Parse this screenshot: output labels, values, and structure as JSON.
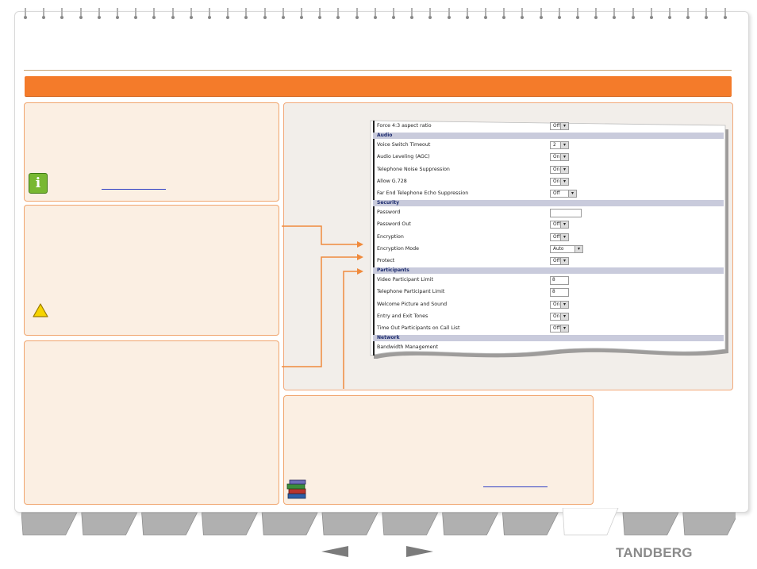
{
  "brand": {
    "name": "TANDBERG"
  },
  "colors": {
    "accent": "#f47b2a",
    "box_border": "#f0a56e",
    "box_fill": "#fbefe3",
    "link": "#2f3fc4",
    "tab": "#b0b0b0"
  },
  "icons": {
    "info": "info-icon",
    "warning": "warning-icon",
    "books": "books-icon",
    "prev": "previous-arrow-icon",
    "next": "next-arrow-icon"
  },
  "info_icon_glyph": "i",
  "settings": {
    "rows": [
      {
        "label": "Force 4:3 aspect ratio",
        "type": "select",
        "value": "Off"
      },
      {
        "section": "Audio"
      },
      {
        "label": "Voice Switch Timeout",
        "type": "select",
        "value": "2"
      },
      {
        "label": "Audio Leveling (AGC)",
        "type": "select",
        "value": "On"
      },
      {
        "label": "Telephone Noise Suppression",
        "type": "select",
        "value": "On"
      },
      {
        "label": "Allow G.728",
        "type": "select",
        "value": "On"
      },
      {
        "label": "Far End Telephone Echo Suppression",
        "type": "select",
        "value": "Off"
      },
      {
        "section": "Security"
      },
      {
        "label": "Password",
        "type": "text",
        "value": ""
      },
      {
        "label": "Password Out",
        "type": "select",
        "value": "Off"
      },
      {
        "label": "Encryption",
        "type": "select",
        "value": "Off"
      },
      {
        "label": "Encryption Mode",
        "type": "select",
        "value": "Auto"
      },
      {
        "label": "Protect",
        "type": "select",
        "value": "Off"
      },
      {
        "section": "Participants"
      },
      {
        "label": "Video Participant Limit",
        "type": "text",
        "value": "8"
      },
      {
        "label": "Telephone Participant Limit",
        "type": "text",
        "value": "8"
      },
      {
        "label": "Welcome Picture and Sound",
        "type": "select",
        "value": "On"
      },
      {
        "label": "Entry and Exit Tones",
        "type": "select",
        "value": "On"
      },
      {
        "label": "Time Out Participants on Call List",
        "type": "select",
        "value": "Off"
      },
      {
        "section": "Network"
      },
      {
        "label": "Bandwidth Management",
        "type": "none",
        "value": ""
      }
    ]
  }
}
